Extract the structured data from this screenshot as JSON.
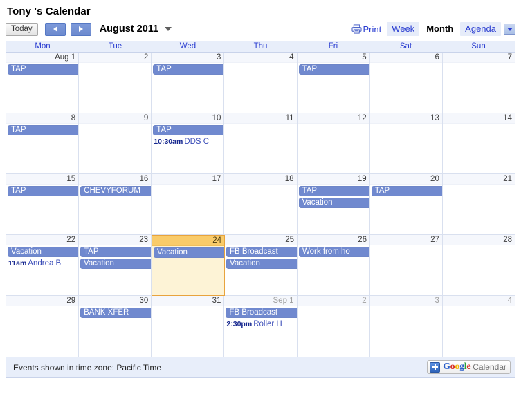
{
  "header": {
    "title": "Tony 's Calendar"
  },
  "toolbar": {
    "today_label": "Today",
    "prev_label": "prev-arrow",
    "next_label": "next-arrow",
    "period_label": "August 2011",
    "print_label": "Print",
    "views": [
      {
        "label": "Week",
        "active": false
      },
      {
        "label": "Month",
        "active": true
      },
      {
        "label": "Agenda",
        "active": false
      }
    ],
    "view_dropdown_label": "view-options"
  },
  "calendar": {
    "weekdays": [
      "Mon",
      "Tue",
      "Wed",
      "Thu",
      "Fri",
      "Sat",
      "Sun"
    ],
    "accent_event_color": "#7089cf",
    "today_header_color": "#f9cb6a",
    "today_body_color": "#fdf3d6",
    "weeks": [
      [
        {
          "day": "Aug 1",
          "other": false,
          "today": false,
          "chips": [
            "TAP"
          ],
          "timed": []
        },
        {
          "day": "2",
          "other": false,
          "today": false,
          "chips": [],
          "timed": []
        },
        {
          "day": "3",
          "other": false,
          "today": false,
          "chips": [
            "TAP"
          ],
          "timed": []
        },
        {
          "day": "4",
          "other": false,
          "today": false,
          "chips": [],
          "timed": []
        },
        {
          "day": "5",
          "other": false,
          "today": false,
          "chips": [
            "TAP"
          ],
          "timed": []
        },
        {
          "day": "6",
          "other": false,
          "today": false,
          "chips": [],
          "timed": []
        },
        {
          "day": "7",
          "other": false,
          "today": false,
          "chips": [],
          "timed": []
        }
      ],
      [
        {
          "day": "8",
          "other": false,
          "today": false,
          "chips": [
            "TAP"
          ],
          "timed": []
        },
        {
          "day": "9",
          "other": false,
          "today": false,
          "chips": [],
          "timed": []
        },
        {
          "day": "10",
          "other": false,
          "today": false,
          "chips": [
            "TAP"
          ],
          "timed": [
            {
              "time": "10:30am",
              "title": "DDS C"
            }
          ]
        },
        {
          "day": "11",
          "other": false,
          "today": false,
          "chips": [],
          "timed": []
        },
        {
          "day": "12",
          "other": false,
          "today": false,
          "chips": [],
          "timed": []
        },
        {
          "day": "13",
          "other": false,
          "today": false,
          "chips": [],
          "timed": []
        },
        {
          "day": "14",
          "other": false,
          "today": false,
          "chips": [],
          "timed": []
        }
      ],
      [
        {
          "day": "15",
          "other": false,
          "today": false,
          "chips": [
            "TAP"
          ],
          "timed": []
        },
        {
          "day": "16",
          "other": false,
          "today": false,
          "chips": [
            "CHEVYFORUM"
          ],
          "timed": []
        },
        {
          "day": "17",
          "other": false,
          "today": false,
          "chips": [],
          "timed": []
        },
        {
          "day": "18",
          "other": false,
          "today": false,
          "chips": [],
          "timed": []
        },
        {
          "day": "19",
          "other": false,
          "today": false,
          "chips": [
            "TAP",
            "Vacation"
          ],
          "timed": []
        },
        {
          "day": "20",
          "other": false,
          "today": false,
          "chips": [
            "TAP"
          ],
          "timed": []
        },
        {
          "day": "21",
          "other": false,
          "today": false,
          "chips": [],
          "timed": []
        }
      ],
      [
        {
          "day": "22",
          "other": false,
          "today": false,
          "chips": [
            "Vacation"
          ],
          "timed": [
            {
              "time": "11am",
              "title": "Andrea B"
            }
          ]
        },
        {
          "day": "23",
          "other": false,
          "today": false,
          "chips": [
            "TAP",
            "Vacation"
          ],
          "timed": []
        },
        {
          "day": "24",
          "other": false,
          "today": true,
          "chips": [
            "Vacation"
          ],
          "timed": []
        },
        {
          "day": "25",
          "other": false,
          "today": false,
          "chips": [
            "FB Broadcast",
            "Vacation"
          ],
          "timed": []
        },
        {
          "day": "26",
          "other": false,
          "today": false,
          "chips": [
            "Work from ho"
          ],
          "timed": []
        },
        {
          "day": "27",
          "other": false,
          "today": false,
          "chips": [],
          "timed": []
        },
        {
          "day": "28",
          "other": false,
          "today": false,
          "chips": [],
          "timed": []
        }
      ],
      [
        {
          "day": "29",
          "other": false,
          "today": false,
          "chips": [],
          "timed": []
        },
        {
          "day": "30",
          "other": false,
          "today": false,
          "chips": [
            "BANK XFER"
          ],
          "timed": []
        },
        {
          "day": "31",
          "other": false,
          "today": false,
          "chips": [],
          "timed": []
        },
        {
          "day": "Sep 1",
          "other": true,
          "today": false,
          "chips": [
            "FB Broadcast"
          ],
          "timed": [
            {
              "time": "2:30pm",
              "title": "Roller H"
            }
          ]
        },
        {
          "day": "2",
          "other": true,
          "today": false,
          "chips": [],
          "timed": []
        },
        {
          "day": "3",
          "other": true,
          "today": false,
          "chips": [],
          "timed": []
        },
        {
          "day": "4",
          "other": true,
          "today": false,
          "chips": [],
          "timed": []
        }
      ]
    ]
  },
  "footer": {
    "timezone_text": "Events shown in time zone: Pacific Time",
    "badge": {
      "google_letters": [
        "G",
        "o",
        "o",
        "g",
        "l",
        "e"
      ],
      "product_word": "Calendar"
    }
  }
}
